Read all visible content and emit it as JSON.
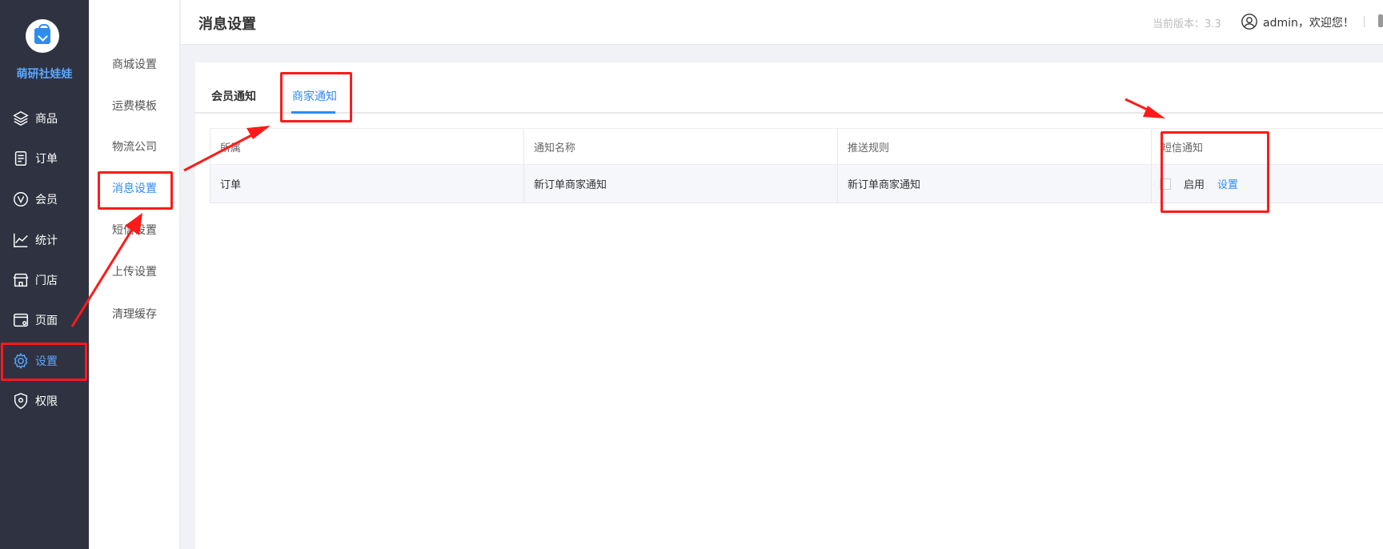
{
  "brand": {
    "name": "萌研社娃娃"
  },
  "sidebar": {
    "items": [
      {
        "label": "商品",
        "icon": "layers-icon"
      },
      {
        "label": "订单",
        "icon": "order-doc-icon"
      },
      {
        "label": "会员",
        "icon": "member-v-icon"
      },
      {
        "label": "统计",
        "icon": "line-chart-icon"
      },
      {
        "label": "门店",
        "icon": "store-icon"
      },
      {
        "label": "页面",
        "icon": "page-window-icon"
      },
      {
        "label": "设置",
        "icon": "gear-icon"
      },
      {
        "label": "权限",
        "icon": "shield-icon"
      }
    ],
    "active_index": 6
  },
  "submenu": {
    "items": [
      "商城设置",
      "运费模板",
      "物流公司",
      "消息设置",
      "短信设置",
      "上传设置",
      "清理缓存"
    ],
    "active_index": 3
  },
  "header": {
    "title": "消息设置",
    "version": "当前版本：3.3",
    "user": "admin，欢迎您！"
  },
  "tabs": {
    "items": [
      "会员通知",
      "商家通知"
    ],
    "active_index": 1
  },
  "table": {
    "headers": [
      "所属",
      "通知名称",
      "推送规则",
      "短信通知"
    ],
    "rows": [
      {
        "category": "订单",
        "name": "新订单商家通知",
        "rule": "新订单商家通知",
        "sms_enable_label": "启用",
        "sms_enabled": false,
        "action": "设置"
      }
    ]
  },
  "colors": {
    "accent": "#2d8cf0",
    "sidebar_bg": "#2f3240",
    "annotation": "#ff1a1a"
  }
}
